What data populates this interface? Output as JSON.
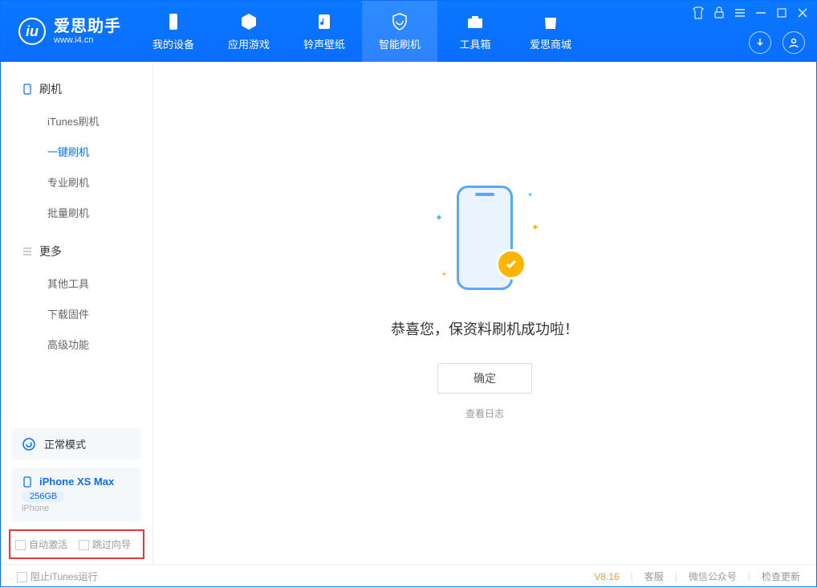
{
  "app": {
    "title": "爱思助手",
    "subtitle": "www.i4.cn"
  },
  "header_tabs": [
    {
      "label": "我的设备"
    },
    {
      "label": "应用游戏"
    },
    {
      "label": "铃声壁纸"
    },
    {
      "label": "智能刷机"
    },
    {
      "label": "工具箱"
    },
    {
      "label": "爱思商城"
    }
  ],
  "sidebar": {
    "group1": "刷机",
    "items1": [
      {
        "label": "iTunes刷机"
      },
      {
        "label": "一键刷机"
      },
      {
        "label": "专业刷机"
      },
      {
        "label": "批量刷机"
      }
    ],
    "group2": "更多",
    "items2": [
      {
        "label": "其他工具"
      },
      {
        "label": "下载固件"
      },
      {
        "label": "高级功能"
      }
    ]
  },
  "mode_card": {
    "label": "正常模式"
  },
  "device": {
    "name": "iPhone XS Max",
    "storage": "256GB",
    "type": "iPhone"
  },
  "options": {
    "auto_activate": "自动激活",
    "skip_guide": "跳过向导"
  },
  "main": {
    "message": "恭喜您，保资料刷机成功啦！",
    "ok": "确定",
    "view_log": "查看日志"
  },
  "footer": {
    "block_itunes": "阻止iTunes运行",
    "version": "V8.16",
    "support": "客服",
    "wechat": "微信公众号",
    "update": "检查更新"
  }
}
